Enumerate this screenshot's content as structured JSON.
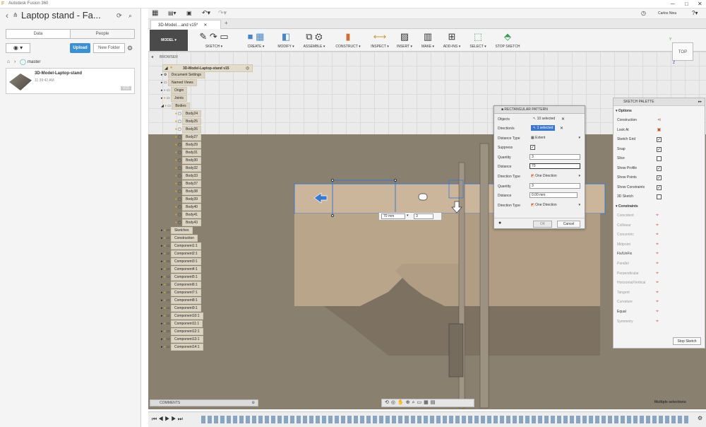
{
  "window": {
    "title": "Autodesk Fusion 360"
  },
  "left_panel": {
    "project_title": "Laptop stand - Fa...",
    "tabs": [
      "Data",
      "People"
    ],
    "upload_label": "Upload",
    "new_folder_label": "New Folder",
    "branch": "master",
    "file": {
      "name": "3D-Model-Laptop-stand",
      "time": "11:39:42 AM",
      "version": "V15"
    }
  },
  "header": {
    "user": "Carlos Nina",
    "document_tab": "3D-Model....and v15*"
  },
  "toolbar": {
    "workspace": "MODEL",
    "groups": [
      "SKETCH",
      "CREATE",
      "MODIFY",
      "ASSEMBLE",
      "CONSTRUCT",
      "INSPECT",
      "INSERT",
      "MAKE",
      "ADD-INS",
      "SELECT",
      "STOP SKETCH"
    ]
  },
  "browser": {
    "title": "BROWSER",
    "root": "3D-Model-Laptop-stand v15",
    "items": [
      "Document Settings",
      "Named Views",
      "Origin",
      "Joints",
      "Bodies"
    ],
    "bodies": [
      "Body24",
      "Body25",
      "Body26",
      "Body27",
      "Body29",
      "Body31",
      "Body30",
      "Body32",
      "Body33",
      "Body37",
      "Body38",
      "Body39",
      "Body40",
      "Body41",
      "Body43"
    ],
    "after": [
      "Sketches",
      "Construction",
      "Component1:1",
      "Component2:1",
      "Component3:1",
      "Component4:1",
      "Component5:1",
      "Component6:1",
      "Component7:1",
      "Component8:1",
      "Component9:1",
      "Component10:1",
      "Component11:1",
      "Component12:1",
      "Component13:1",
      "Component14:1"
    ]
  },
  "rect_pattern": {
    "title": "RECTANGULAR PATTERN",
    "objects_label": "Objects",
    "objects_value": "10 selected",
    "directions_label": "Direction/s",
    "directions_value": "1 selected",
    "distance_type_label": "Distance Type",
    "distance_type_value": "Extent",
    "suppress_label": "Suppress",
    "quantity_label": "Quantity",
    "quantity_value": "3",
    "distance_label": "Distance",
    "distance_value": "70",
    "direction_type_label": "Direction Type",
    "direction_type_value": "One Direction",
    "quantity2_value": "3",
    "distance2_value": "0.00 mm",
    "direction_type2_value": "One Direction",
    "ok_label": "OK",
    "cancel_label": "Cancel"
  },
  "viewport": {
    "dim_input": "70 mm",
    "qty_input": "3",
    "view_label": "TOP"
  },
  "sketch_palette": {
    "title": "SKETCH PALETTE",
    "options_label": "Options",
    "options": [
      {
        "label": "Construction",
        "checked": null
      },
      {
        "label": "Look At",
        "checked": null
      },
      {
        "label": "Sketch Grid",
        "checked": true
      },
      {
        "label": "Snap",
        "checked": true
      },
      {
        "label": "Slice",
        "checked": false
      },
      {
        "label": "Show Profile",
        "checked": true
      },
      {
        "label": "Show Points",
        "checked": true
      },
      {
        "label": "Show Constraints",
        "checked": true
      },
      {
        "label": "3D Sketch",
        "checked": false
      }
    ],
    "constraints_label": "Constraints",
    "constraints": [
      "Coincident",
      "Collinear",
      "Concentric",
      "Midpoint",
      "Fix/UnFix",
      "Parallel",
      "Perpendicular",
      "Horizontal/Vertical",
      "Tangent",
      "Curvature",
      "Equal",
      "Symmetry"
    ],
    "stop_sketch_label": "Stop Sketch"
  },
  "status": {
    "comments": "COMMENTS",
    "selection": "Multiple selections"
  },
  "colors": {
    "accent": "#3a90d0",
    "ground": "#8a806f",
    "body": "#c7b29a"
  }
}
